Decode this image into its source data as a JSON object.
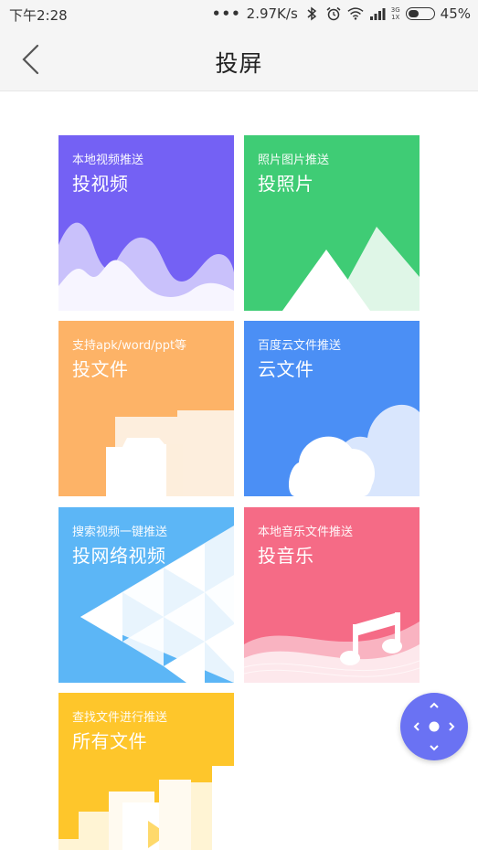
{
  "status_bar": {
    "time": "下午2:28",
    "dots": "•••",
    "speed": "2.97K/s",
    "network_top": "3G",
    "network_bottom": "1X",
    "battery": "45%",
    "battery_level": 0.45
  },
  "header": {
    "title": "投屏"
  },
  "tiles": [
    {
      "subtitle": "本地视频推送",
      "title": "投视频",
      "color": "#7461f4"
    },
    {
      "subtitle": "照片图片推送",
      "title": "投照片",
      "color": "#3fcc75"
    },
    {
      "subtitle": "支持apk/word/ppt等",
      "title": "投文件",
      "color": "#fdb367"
    },
    {
      "subtitle": "百度云文件推送",
      "title": "云文件",
      "color": "#4b8ff5"
    },
    {
      "subtitle": "搜索视频一键推送",
      "title": "投网络视频",
      "color": "#5cb6f6"
    },
    {
      "subtitle": "本地音乐文件推送",
      "title": "投音乐",
      "color": "#f56b86"
    },
    {
      "subtitle": "查找文件进行推送",
      "title": "所有文件",
      "color": "#fec62b"
    }
  ],
  "fab": {
    "icon": "remote-control-icon",
    "color": "#6a72f3"
  }
}
